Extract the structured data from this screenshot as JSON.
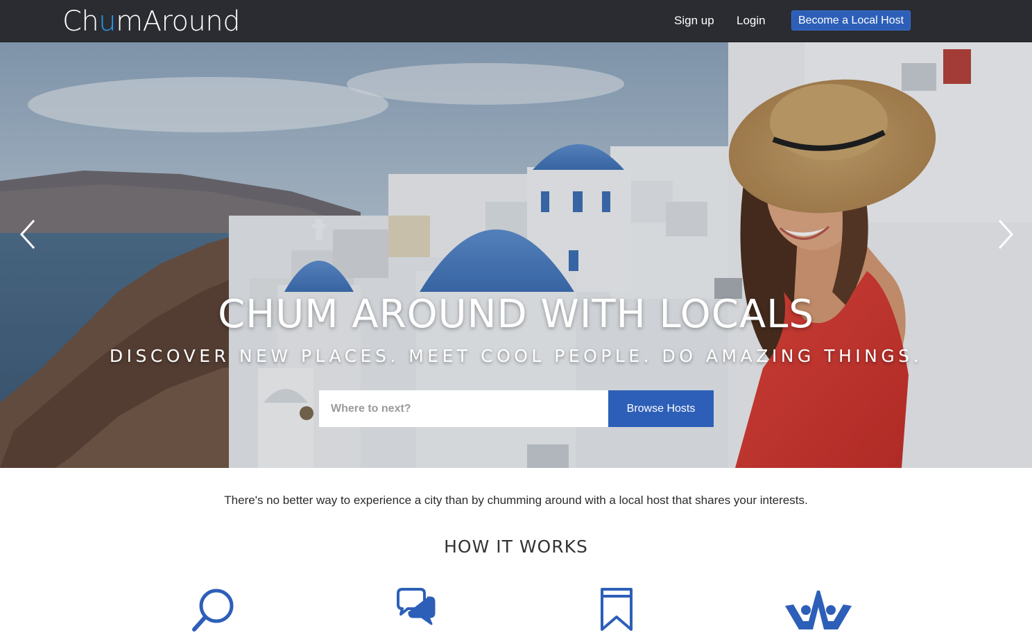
{
  "navbar": {
    "logo_prefix": "Ch",
    "logo_u": "u",
    "logo_suffix": "mAround",
    "signup_label": "Sign up",
    "login_label": "Login",
    "become_host_label": "Become a Local Host",
    "accent_color": "#2d5fb8",
    "logo_accent_color": "#2a97e6"
  },
  "hero": {
    "title": "CHUM AROUND WITH LOCALS",
    "subtitle": "DISCOVER NEW PLACES. MEET COOL PEOPLE. DO AMAZING THINGS.",
    "search_placeholder": "Where to next?",
    "search_value": "",
    "browse_label": "Browse Hosts",
    "prev_icon": "chevron-left-icon",
    "next_icon": "chevron-right-icon"
  },
  "intro": {
    "text": "There's no better way to experience a city than by chumming around with a local host that shares your interests."
  },
  "how_it_works": {
    "title": "HOW IT WORKS",
    "steps": [
      {
        "icon": "search-icon"
      },
      {
        "icon": "chat-bubbles-icon"
      },
      {
        "icon": "bookmark-icon"
      },
      {
        "icon": "people-celebrate-icon"
      }
    ],
    "icon_color": "#2d5fb8"
  }
}
